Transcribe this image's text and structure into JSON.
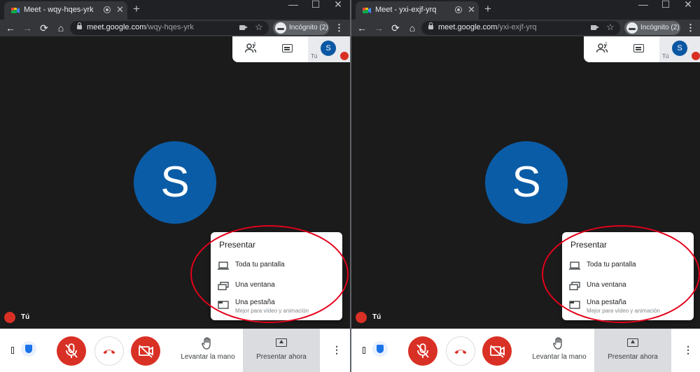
{
  "windows": [
    {
      "tab": {
        "title": "Meet - wqy-hqes-yrk",
        "close_glyph": "✕"
      },
      "window_controls": {
        "minimize": "—",
        "maximize": "☐",
        "close": "✕"
      },
      "toolbar": {
        "back": "←",
        "forward": "→",
        "reload": "⟳",
        "home": "⌂",
        "url_host": "meet.google.com",
        "url_path": "/wqy-hqes-yrk",
        "star": "☆",
        "incognito_label": "Incógnito (2)",
        "menu": "⋮"
      },
      "meet_panel": {
        "participant_count": "1",
        "avatar_letter": "S",
        "self_label": "Tú"
      },
      "main": {
        "avatar_letter": "S",
        "self_name": "Tú"
      },
      "present_menu": {
        "title": "Presentar",
        "items": [
          {
            "label": "Toda tu pantalla",
            "sublabel": ""
          },
          {
            "label": "Una ventana",
            "sublabel": ""
          },
          {
            "label": "Una pestaña",
            "sublabel": "Mejor para vídeo y animación"
          }
        ]
      },
      "bottom_bar": {
        "raise_hand_label": "Levantar la mano",
        "present_now_label": "Presentar ahora",
        "more": "⋮"
      }
    },
    {
      "tab": {
        "title": "Meet - yxi-exjf-yrq",
        "close_glyph": "✕"
      },
      "window_controls": {
        "minimize": "—",
        "maximize": "☐",
        "close": "✕"
      },
      "toolbar": {
        "back": "←",
        "forward": "→",
        "reload": "⟳",
        "home": "⌂",
        "url_host": "meet.google.com",
        "url_path": "/yxi-exjf-yrq",
        "star": "☆",
        "incognito_label": "Incógnito (2)",
        "menu": "⋮"
      },
      "meet_panel": {
        "participant_count": "1",
        "avatar_letter": "S",
        "self_label": "Tú"
      },
      "main": {
        "avatar_letter": "S",
        "self_name": "Tú"
      },
      "present_menu": {
        "title": "Presentar",
        "items": [
          {
            "label": "Toda tu pantalla",
            "sublabel": ""
          },
          {
            "label": "Una ventana",
            "sublabel": ""
          },
          {
            "label": "Una pestaña",
            "sublabel": "Mejor para vídeo y animación"
          }
        ]
      },
      "bottom_bar": {
        "raise_hand_label": "Levantar la mano",
        "present_now_label": "Presentar ahora",
        "more": "⋮"
      }
    }
  ],
  "colors": {
    "avatar_blue": "#0b5ca6",
    "mute_red": "#d93025",
    "annotation_red": "#e3001b"
  }
}
